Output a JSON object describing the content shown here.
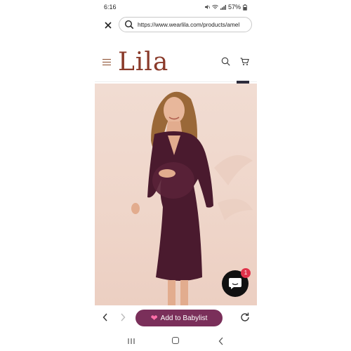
{
  "status_bar": {
    "time": "6:16",
    "battery": "57%"
  },
  "browser": {
    "url": "https://www.wearlila.com/products/amel"
  },
  "site": {
    "logo": "Lila"
  },
  "product": {
    "image_description_icon": "product-photo"
  },
  "chat": {
    "badge_count": "1"
  },
  "toolbar": {
    "babylist_label": "Add to Babylist"
  },
  "colors": {
    "brand": "#8a3a2a",
    "babylist_button": "#7a2f5a",
    "dress": "#4a1a2e",
    "chat_badge": "#e0324a"
  }
}
